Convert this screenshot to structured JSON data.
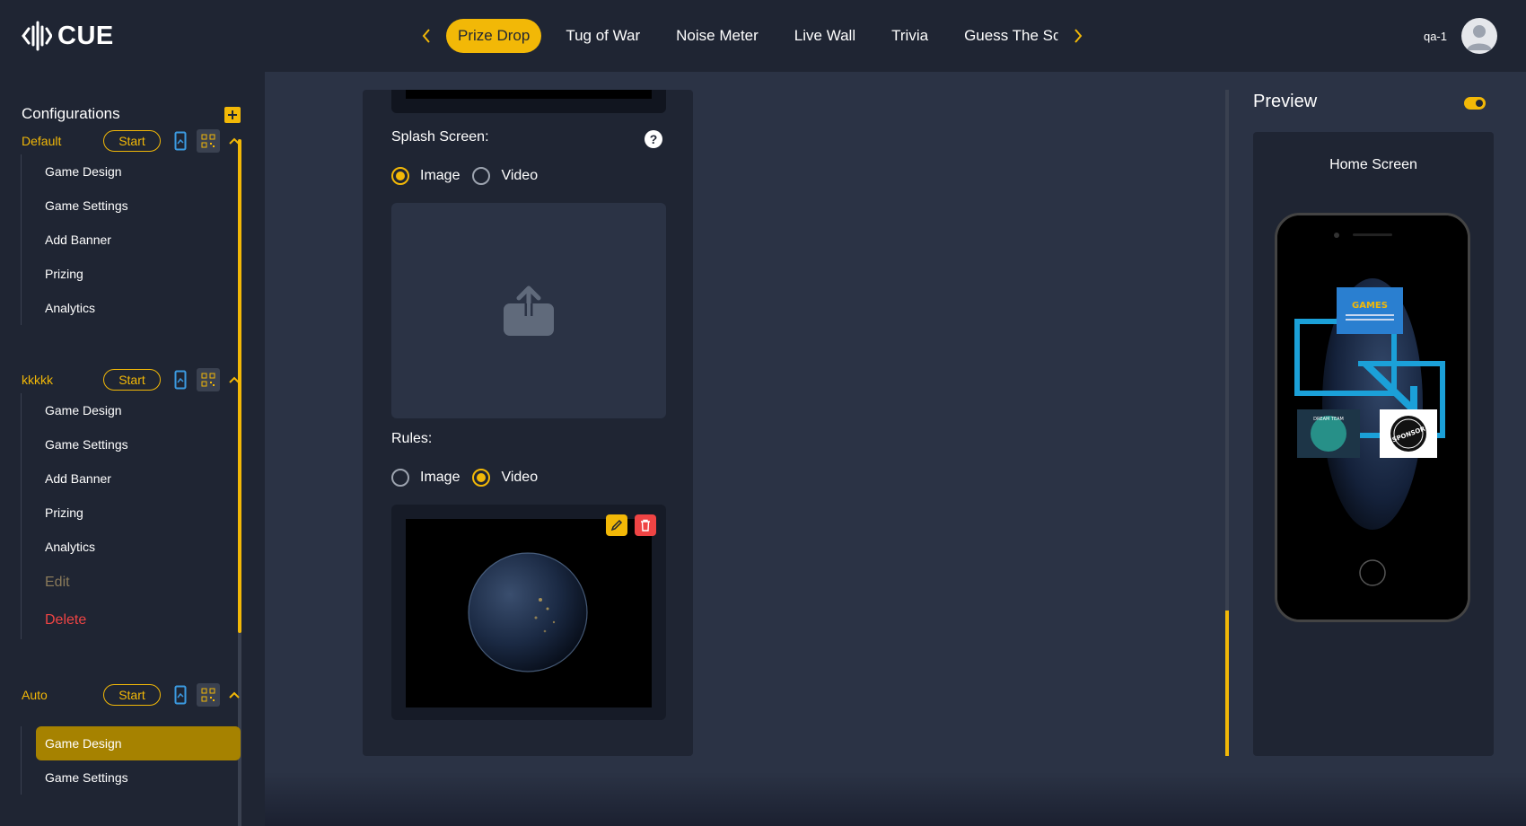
{
  "app": {
    "logo_text": "CUE"
  },
  "topbar": {
    "tabs": [
      {
        "label": "Prize Drop",
        "active": true
      },
      {
        "label": "Tug of War",
        "active": false
      },
      {
        "label": "Noise Meter",
        "active": false
      },
      {
        "label": "Live Wall",
        "active": false
      },
      {
        "label": "Trivia",
        "active": false
      },
      {
        "label": "Guess The Sc",
        "active": false
      }
    ],
    "user_name": "qa-1"
  },
  "sidebar": {
    "title": "Configurations",
    "configs": [
      {
        "name": "Default",
        "start_label": "Start",
        "expanded": true,
        "items": [
          "Game Design",
          "Game Settings",
          "Add Banner",
          "Prizing",
          "Analytics"
        ]
      },
      {
        "name": "kkkkk",
        "start_label": "Start",
        "expanded": true,
        "items": [
          "Game Design",
          "Game Settings",
          "Add Banner",
          "Prizing",
          "Analytics"
        ],
        "edit_label": "Edit",
        "delete_label": "Delete"
      },
      {
        "name": "Auto",
        "start_label": "Start",
        "expanded": true,
        "items": [
          "Game Design",
          "Game Settings"
        ],
        "active_item": "Game Design"
      }
    ]
  },
  "form": {
    "splash_screen": {
      "label": "Splash Screen:",
      "help": "?",
      "options": [
        "Image",
        "Video"
      ],
      "selected": "Image"
    },
    "rules": {
      "label": "Rules:",
      "options": [
        "Image",
        "Video"
      ],
      "selected": "Video"
    }
  },
  "preview": {
    "title": "Preview",
    "toggle_on": true,
    "screen_title": "Home Screen",
    "images": {
      "games_text": "GAMES",
      "team_text": "DREAM TEAM",
      "sponsor_text": "SPONSOR"
    }
  },
  "colors": {
    "accent": "#f2b807",
    "background": "#1f2533",
    "panel": "#2b3345",
    "danger": "#ef4444"
  }
}
